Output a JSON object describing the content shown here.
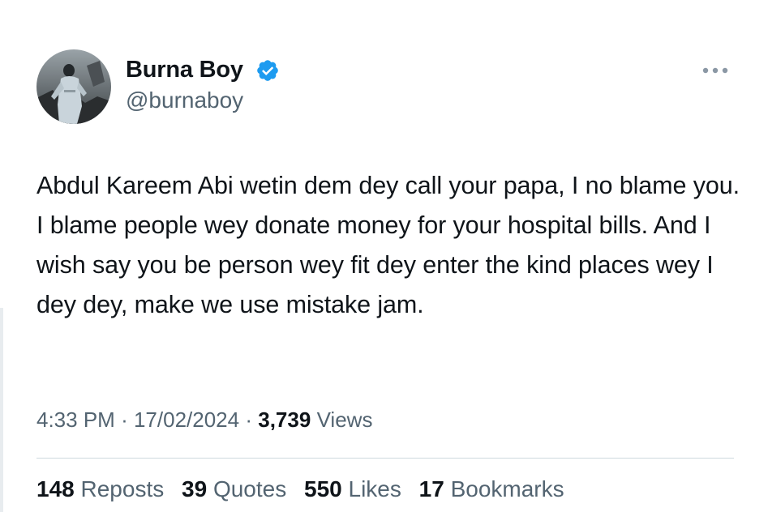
{
  "author": {
    "name": "Burna Boy",
    "handle": "@burnaboy",
    "verified_color": "#1d9bf0"
  },
  "tweet": {
    "text": "Abdul Kareem Abi wetin dem dey call your papa, I no blame you. I blame people wey donate money for your hospital bills. And I wish say you be person wey fit dey enter the kind places wey I dey dey, make we use mistake jam."
  },
  "meta": {
    "time": "4:33 PM",
    "separator": "·",
    "date": "17/02/2024",
    "views_count": "3,739",
    "views_label": "Views"
  },
  "stats": [
    {
      "count": "148",
      "label": "Reposts"
    },
    {
      "count": "39",
      "label": "Quotes"
    },
    {
      "count": "550",
      "label": "Likes"
    },
    {
      "count": "17",
      "label": "Bookmarks"
    }
  ],
  "icons": {
    "verified": "verified-badge-icon",
    "more": "more-options-icon"
  }
}
